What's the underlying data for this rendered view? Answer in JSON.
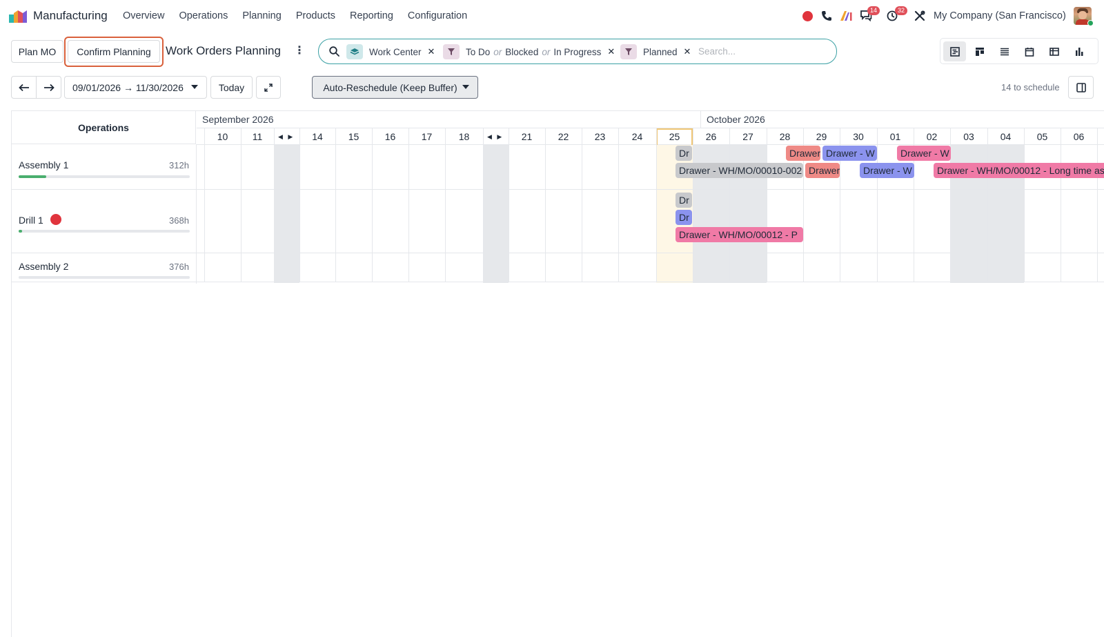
{
  "navbar": {
    "app_name": "Manufacturing",
    "menu": [
      "Overview",
      "Operations",
      "Planning",
      "Products",
      "Reporting",
      "Configuration"
    ],
    "messages_badge": "14",
    "activities_badge": "32",
    "company": "My Company (San Francisco)"
  },
  "control": {
    "plan_mo": "Plan MO",
    "confirm_planning": "Confirm Planning",
    "title": "Work Orders Planning",
    "facets": {
      "work_center": "Work Center",
      "status_1": "To Do",
      "status_or_1": "or",
      "status_2": "Blocked",
      "status_or_2": "or",
      "status_3": "In Progress",
      "planned": "Planned"
    },
    "search_placeholder": "Search...",
    "date_range": "09/01/2026 → 11/30/2026",
    "today": "Today",
    "reschedule": "Auto-Reschedule (Keep Buffer)",
    "to_schedule": "14 to schedule"
  },
  "gantt": {
    "header_title": "Operations",
    "month_sep": "September 2026",
    "month_oct": "October 2026",
    "days": [
      "10",
      "11",
      "14",
      "15",
      "16",
      "17",
      "18",
      "21",
      "22",
      "23",
      "24",
      "25",
      "26",
      "27",
      "28",
      "29",
      "30",
      "01",
      "02",
      "03",
      "04",
      "05",
      "06"
    ],
    "rows": [
      {
        "name": "Assembly 1",
        "hours": "312h",
        "load": 0.16
      },
      {
        "name": "Drill 1",
        "hours": "368h",
        "load": 0.02
      },
      {
        "name": "Assembly 2",
        "hours": "376h",
        "load": 0
      }
    ],
    "pills": {
      "a1_dr": "Dr",
      "a1_mo10": "Drawer - WH/MO/00010-002",
      "a1_drawer_red1": "Drawer",
      "a1_drawer_red2": "Drawer",
      "a1_blue1": "Drawer - W",
      "a1_blue2": "Drawer - W",
      "a1_pink1": "Drawer - W",
      "a1_mo12": "Drawer - WH/MO/00012 - Long time as",
      "d1_dr_gray": "Dr",
      "d1_dr_blue": "Dr",
      "d1_mo12": "Drawer - WH/MO/00012 - P"
    }
  },
  "colors": {
    "accent": "#3aa0a4",
    "highlight": "#d9603b",
    "pill_gray": "#c8c9cc",
    "pill_red": "#ef8a86",
    "pill_blue": "#8b93ee",
    "pill_pink": "#f07aa6",
    "today_bg": "#fef7e6",
    "weekend": "#e6e8eb",
    "load_green": "#4aae6e"
  }
}
